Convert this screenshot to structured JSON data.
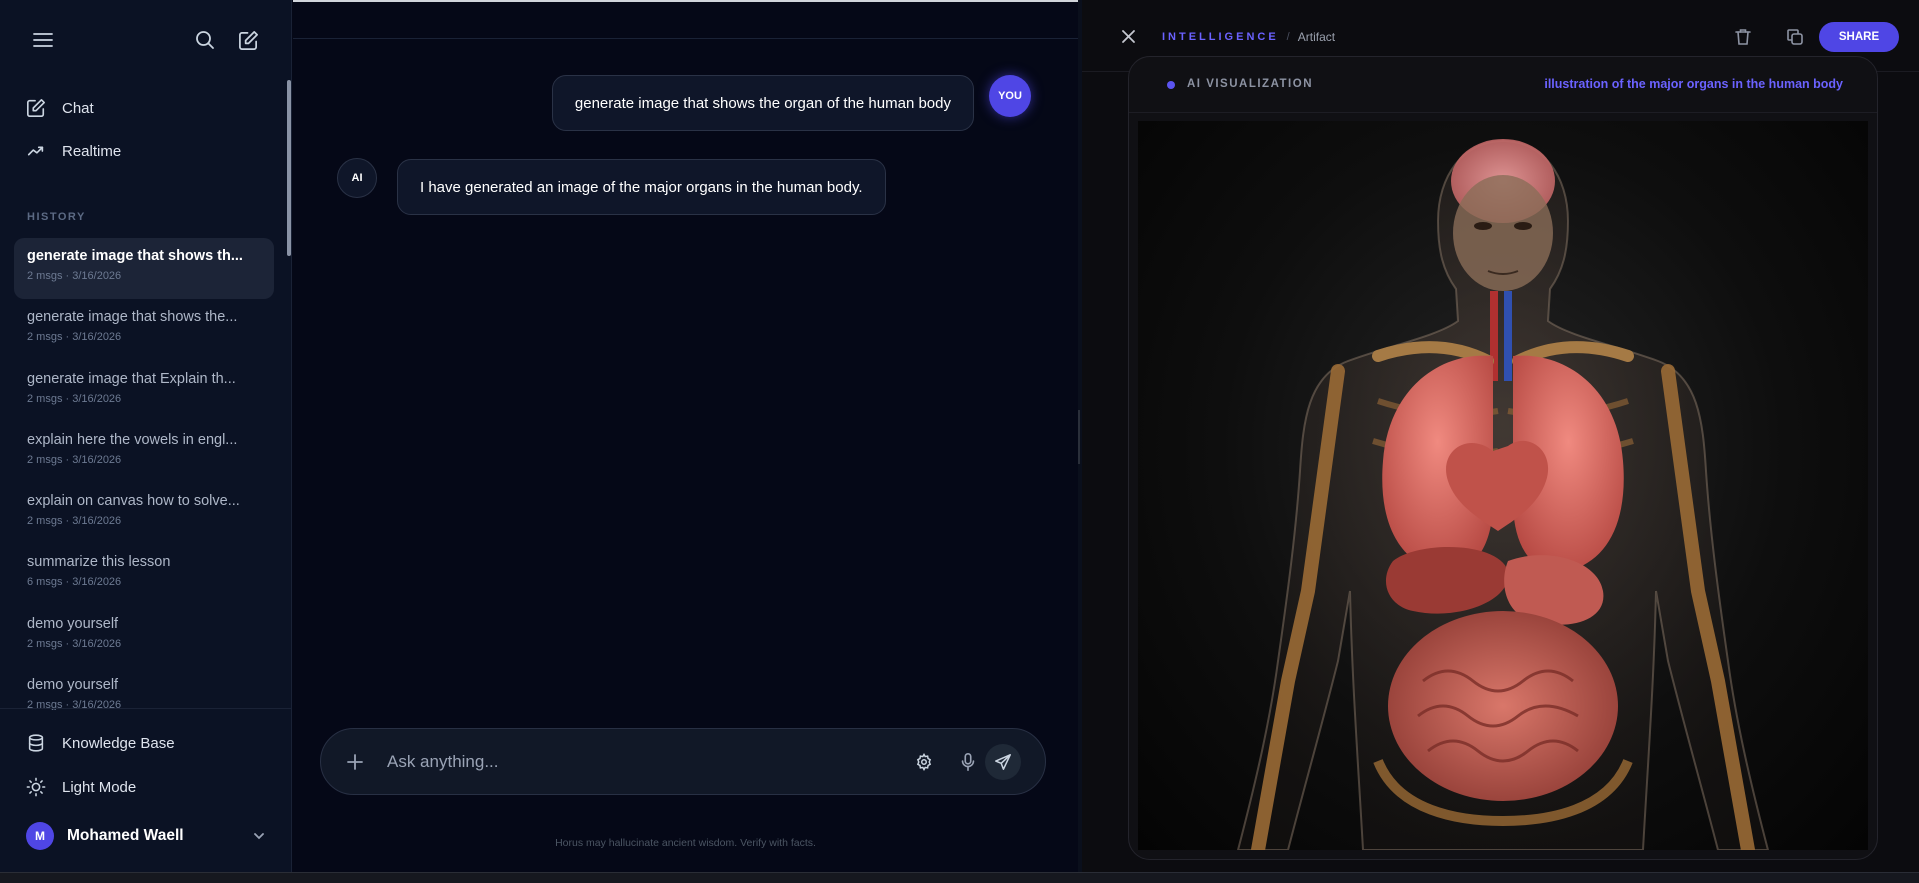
{
  "sidebar": {
    "nav": [
      {
        "label": "Chat",
        "icon": "edit-icon"
      },
      {
        "label": "Realtime",
        "icon": "activity-icon"
      }
    ],
    "history_title": "HISTORY",
    "history": [
      {
        "title": "generate image that shows th...",
        "meta": "2 msgs · 3/16/2026",
        "active": true
      },
      {
        "title": "generate image that shows the...",
        "meta": "2 msgs · 3/16/2026"
      },
      {
        "title": "generate image that Explain th...",
        "meta": "2 msgs · 3/16/2026"
      },
      {
        "title": "explain here the vowels in engl...",
        "meta": "2 msgs · 3/16/2026"
      },
      {
        "title": "explain on canvas how to solve...",
        "meta": "2 msgs · 3/16/2026"
      },
      {
        "title": "summarize this lesson",
        "meta": "6 msgs · 3/16/2026"
      },
      {
        "title": "demo yourself",
        "meta": "2 msgs · 3/16/2026"
      },
      {
        "title": "demo yourself",
        "meta": "2 msgs · 3/16/2026"
      }
    ],
    "bottom": {
      "knowledge_base": "Knowledge Base",
      "light_mode": "Light Mode"
    },
    "user": {
      "initial": "M",
      "name": "Mohamed Waell"
    }
  },
  "chat": {
    "messages": [
      {
        "role": "user",
        "badge": "YOU",
        "text": "generate image that shows the organ of the human body"
      },
      {
        "role": "ai",
        "badge": "AI",
        "text": "I have generated an image of the major organs in the human body."
      }
    ],
    "input_placeholder": "Ask anything...",
    "disclaimer": "Horus may hallucinate ancient wisdom. Verify with facts."
  },
  "artifact": {
    "crumb_main": "INTELLIGENCE",
    "crumb_sep": "/",
    "crumb_sub": "Artifact",
    "share_label": "SHARE",
    "viz_label": "AI VISUALIZATION",
    "viz_caption": "illustration of the major organs in the human body"
  },
  "colors": {
    "accent": "#4f46e5",
    "accent_text": "#6b62ff",
    "background": "#050817",
    "sidebar": "#0b1224"
  }
}
